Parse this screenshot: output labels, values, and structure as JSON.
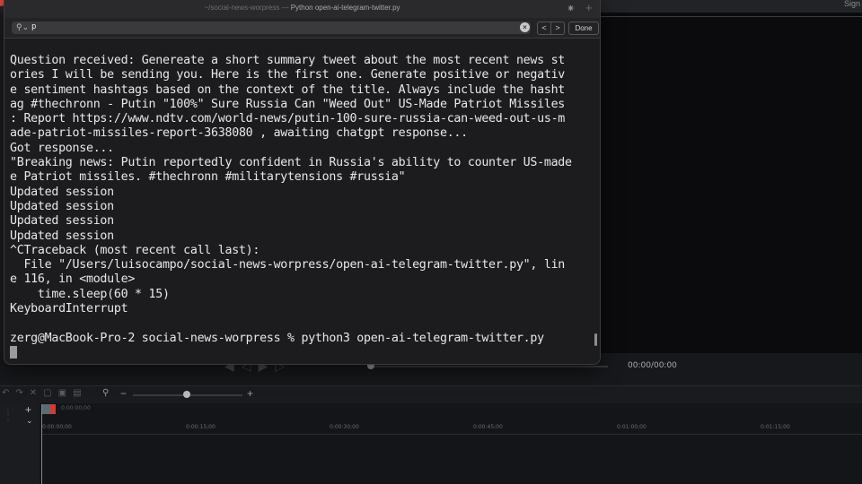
{
  "editor": {
    "sign_label": "Sign",
    "time_readout": "00:00/00:00",
    "small_timecode": "0:00:00;00",
    "ruler_labels": [
      "0:00:00;00",
      "0:00:15;00",
      "0:00:30;00",
      "0:00:45;00",
      "0:01:00;00",
      "0:01:15;00"
    ]
  },
  "terminal": {
    "title_dim": "~/social-news-worpress — ",
    "title_main": "Python open-ai-telegram-twitter.py",
    "find": {
      "query": "p",
      "done_label": "Done",
      "prev_label": "<",
      "next_label": ">",
      "clear_label": "×"
    },
    "lines": [
      "Question received: Genereate a short summary tweet about the most recent news st",
      "ories I will be sending you. Here is the first one. Generate positive or negativ",
      "e sentiment hashtags based on the context of the title. Always include the hasht",
      "ag #thechronn - Putin \"100%\" Sure Russia Can \"Weed Out\" US-Made Patriot Missiles",
      ": Report https://www.ndtv.com/world-news/putin-100-sure-russia-can-weed-out-us-m",
      "ade-patriot-missiles-report-3638080 , awaiting chatgpt response...",
      "Got response...",
      "\"Breaking news: Putin reportedly confident in Russia's ability to counter US-made",
      "e Patriot missiles. #thechronn #militarytensions #russia\"",
      "Updated session",
      "Updated session",
      "Updated session",
      "Updated session",
      "^CTraceback (most recent call last):",
      "  File \"/Users/luisocampo/social-news-worpress/open-ai-telegram-twitter.py\", lin",
      "e 116, in <module>",
      "    time.sleep(60 * 15)",
      "KeyboardInterrupt",
      "",
      "zerg@MacBook-Pro-2 social-news-worpress % python3 open-ai-telegram-twitter.py"
    ]
  }
}
